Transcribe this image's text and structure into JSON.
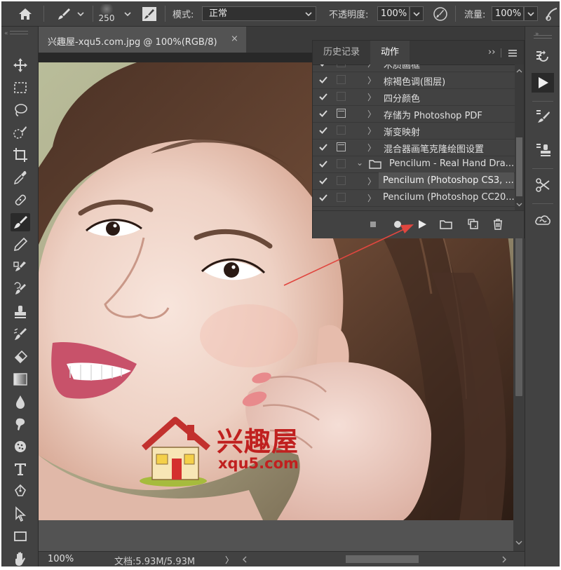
{
  "options_bar": {
    "brush_size": "250",
    "mode_label": "模式:",
    "mode_value": "正常",
    "opacity_label": "不透明度:",
    "opacity_value": "100%",
    "flow_label": "流量:",
    "flow_value": "100%"
  },
  "document": {
    "tab_title": "兴趣屋-xqu5.com.jpg @ 100%(RGB/8)",
    "close_glyph": "×",
    "zoom": "100%",
    "doc_info": "文档:5.93M/5.93M",
    "status_arrow": "〉"
  },
  "watermark": {
    "cn_text": "兴趣屋",
    "url_text": "xqu5.com"
  },
  "panel": {
    "tabs": [
      "历史记录",
      "动作"
    ],
    "active_tab": "动作",
    "menu_glyph": "››",
    "actions": [
      {
        "name": "木质画框",
        "checked": true,
        "dialog": false,
        "expand": "〉",
        "indent": 0
      },
      {
        "name": "棕褐色调(图层)",
        "checked": true,
        "dialog": false,
        "expand": "〉",
        "indent": 0
      },
      {
        "name": "四分颜色",
        "checked": true,
        "dialog": false,
        "expand": "〉",
        "indent": 0
      },
      {
        "name": "存储为 Photoshop PDF",
        "checked": true,
        "dialog": true,
        "expand": "〉",
        "indent": 0
      },
      {
        "name": "渐变映射",
        "checked": true,
        "dialog": false,
        "expand": "〉",
        "indent": 0
      },
      {
        "name": "混合器画笔克隆绘图设置",
        "checked": true,
        "dialog": true,
        "expand": "〉",
        "indent": 0
      },
      {
        "name": "Pencilum - Real Hand Dra...",
        "checked": true,
        "dialog": false,
        "expand": "⌄",
        "indent": 0,
        "folder": true
      },
      {
        "name": "Pencilum (Photoshop CS3, ...",
        "checked": true,
        "dialog": false,
        "expand": "〉",
        "indent": 1,
        "selected": true
      },
      {
        "name": "Pencilum (Photoshop CC20...",
        "checked": true,
        "dialog": false,
        "expand": "〉",
        "indent": 1
      }
    ],
    "bottom_buttons": [
      "stop-icon",
      "record-icon",
      "play-icon",
      "new-set-icon",
      "new-action-icon",
      "delete-icon"
    ]
  },
  "colors": {
    "accent_arrow": "#e0463f",
    "panel_bg": "#424242",
    "ui_dark": "#535353"
  }
}
